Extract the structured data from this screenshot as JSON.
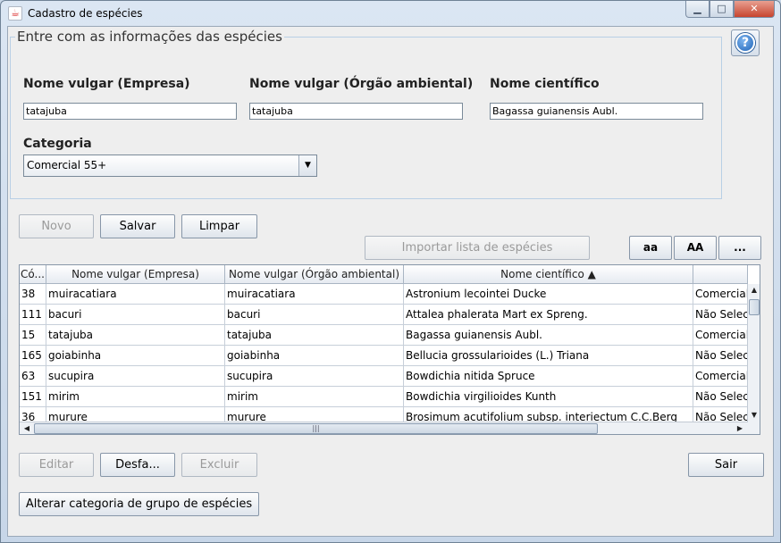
{
  "window": {
    "title": "Cadastro de espécies",
    "app_icon": "java-icon",
    "controls": {
      "minimize": "▁",
      "maximize": "□",
      "close": "✕"
    }
  },
  "form": {
    "group_title": "Entre com as informações das espécies",
    "help_icon": "question-icon",
    "help_symbol": "?",
    "fields": {
      "nome_empresa": {
        "label": "Nome vulgar (Empresa)",
        "value": "tatajuba"
      },
      "nome_orgao": {
        "label": "Nome vulgar (Órgão ambiental)",
        "value": "tatajuba"
      },
      "nome_cientifico": {
        "label": "Nome científico",
        "value": "Bagassa guianensis Aubl."
      }
    },
    "categoria": {
      "label": "Categoria",
      "value": "Comercial 55+",
      "arrow": "▼"
    }
  },
  "actions": {
    "novo": "Novo",
    "salvar": "Salvar",
    "limpar": "Limpar",
    "importar": "Importar lista de espécies",
    "lower_case": "aa",
    "upper_case": "AA",
    "more": "..."
  },
  "table": {
    "columns": [
      "Có...",
      "Nome vulgar (Empresa)",
      "Nome vulgar (Órgão ambiental)",
      "Nome científico ▲",
      ""
    ],
    "rows": [
      [
        "38",
        "muiracatiara",
        "muiracatiara",
        "Astronium lecointei Ducke",
        "Comercial"
      ],
      [
        "111",
        "bacuri",
        "bacuri",
        "Attalea phalerata Mart ex Spreng.",
        "Não Selec"
      ],
      [
        "15",
        "tatajuba",
        "tatajuba",
        "Bagassa guianensis Aubl.",
        "Comercial"
      ],
      [
        "165",
        "goiabinha",
        "goiabinha",
        "Bellucia grossularioides (L.) Triana",
        "Não Selec"
      ],
      [
        "63",
        "sucupira",
        "sucupira",
        "Bowdichia nitida Spruce",
        "Comercial"
      ],
      [
        "151",
        "mirim",
        "mirim",
        "Bowdichia virgilioides Kunth",
        "Não Selec"
      ],
      [
        "36",
        "murure",
        "murure",
        "Brosimum acutifolium subsp. interiectum C.C.Berg",
        "Não Selec"
      ]
    ],
    "scroll": {
      "up": "▲",
      "down": "▼",
      "left": "◀",
      "right": "▶",
      "grip": "|||"
    }
  },
  "bottom": {
    "editar": "Editar",
    "desfazer": "Desfa...",
    "excluir": "Excluir",
    "sair": "Sair",
    "alterar": "Alterar categoria de grupo de espécies"
  }
}
